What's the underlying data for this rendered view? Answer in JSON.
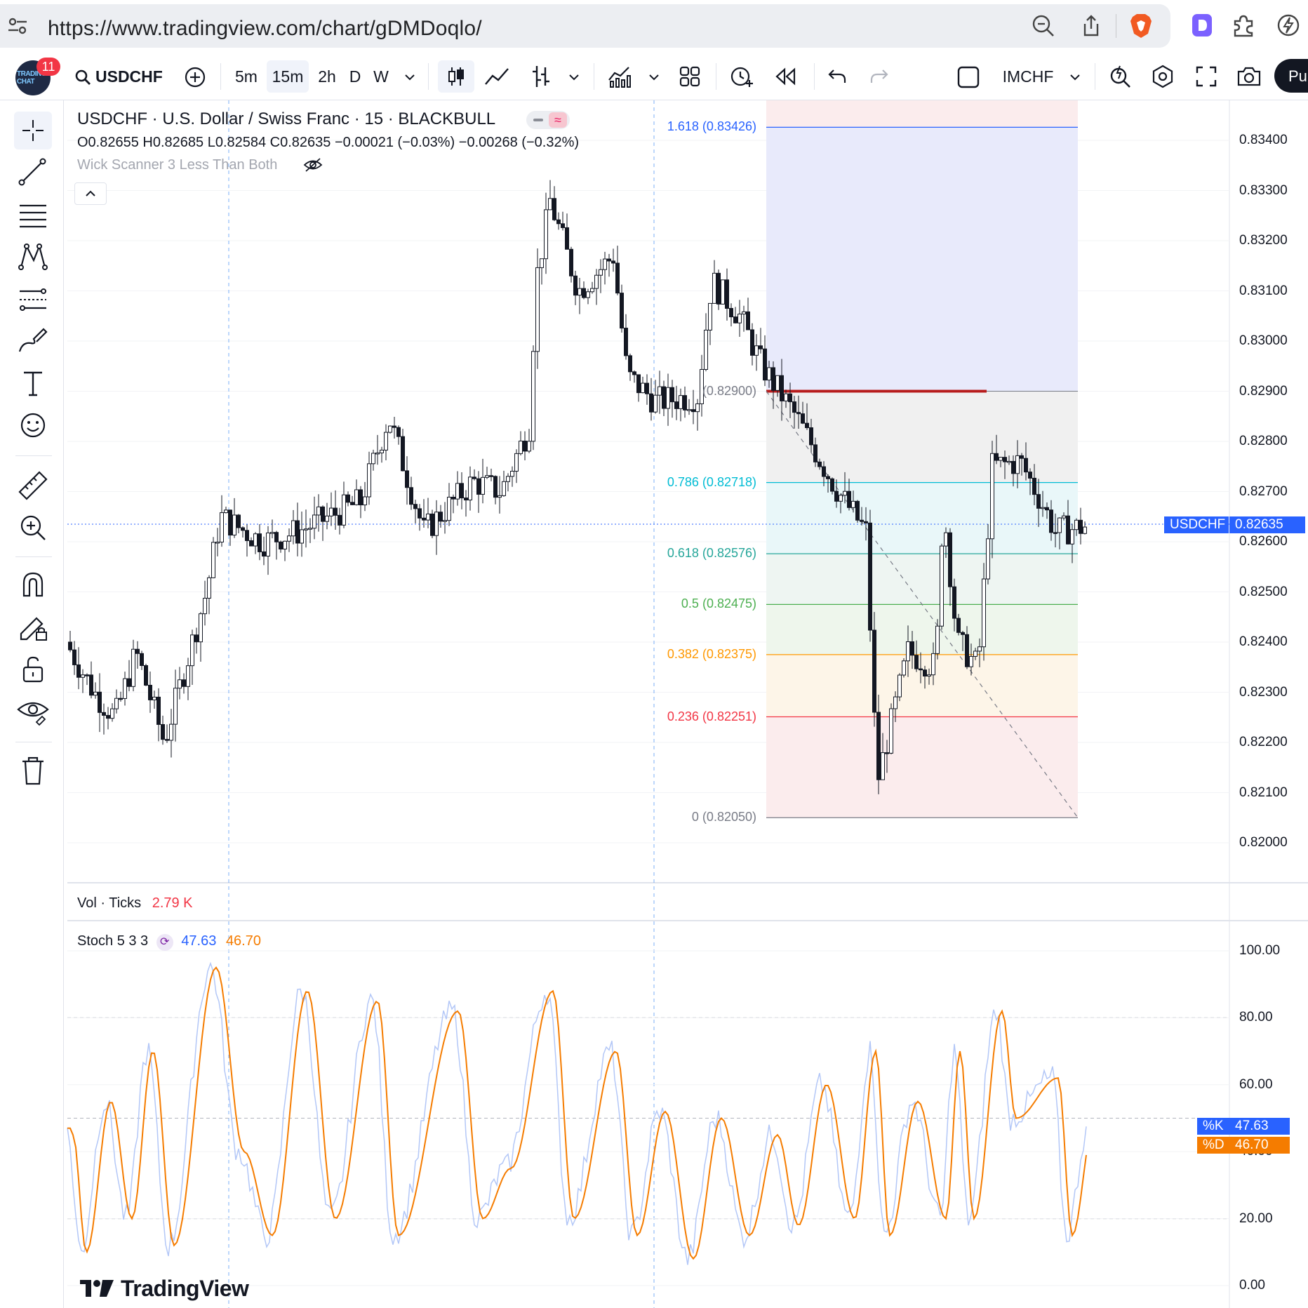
{
  "browser": {
    "url": "https://www.tradingview.com/chart/gDMDoqlo/"
  },
  "toolbar": {
    "symbol": "USDCHF",
    "badge_count": "11",
    "intervals": [
      "5m",
      "15m",
      "2h",
      "D",
      "W"
    ],
    "active_interval": "15m",
    "compare_symbol": "IMCHF",
    "publish_label": "Pu"
  },
  "legend": {
    "title": "USDCHF · U.S. Dollar / Swiss Franc · 15 · BLACKBULL",
    "ohlc": "O0.82655  H0.82685  L0.82584  C0.82635  −0.00021 (−0.03%)  −0.00268 (−0.32%)",
    "indicator": "Wick Scanner 3 Less Than Both"
  },
  "price_axis": [
    "0.83400",
    "0.83300",
    "0.83200",
    "0.83100",
    "0.83000",
    "0.82900",
    "0.82800",
    "0.82700",
    "0.82600",
    "0.82500",
    "0.82400",
    "0.82300",
    "0.82200",
    "0.82100",
    "0.82000"
  ],
  "current_price": {
    "label": "USDCHF",
    "value": "0.82635",
    "color": "#2962ff"
  },
  "fib": {
    "levels": [
      {
        "label": "1.618 (0.83426)",
        "color": "#2962ff"
      },
      {
        "label": "0.786 (0.82718)",
        "color": "#00bcd4"
      },
      {
        "label": "0.618 (0.82576)",
        "color": "#26a69a"
      },
      {
        "label": "0.5 (0.82475)",
        "color": "#4caf50"
      },
      {
        "label": "0.382 (0.82375)",
        "color": "#ff9800"
      },
      {
        "label": "0.236 (0.82251)",
        "color": "#f23645"
      },
      {
        "label": "0 (0.82050)",
        "color": "#787b86"
      }
    ],
    "base_label": "(0.82900)"
  },
  "volume": {
    "label": "Vol · Ticks",
    "value": "2.79 K",
    "value_color": "#f23645"
  },
  "stoch": {
    "label": "Stoch 5 3 3",
    "k_value": "47.63",
    "d_value": "46.70",
    "k_color": "#2962ff",
    "d_color": "#f57c00",
    "k_tag": "%K",
    "d_tag": "%D",
    "axis": [
      "100.00",
      "80.00",
      "60.00",
      "40.00",
      "20.00",
      "0.00"
    ]
  },
  "branding": {
    "logo_text": "TradingView"
  }
}
